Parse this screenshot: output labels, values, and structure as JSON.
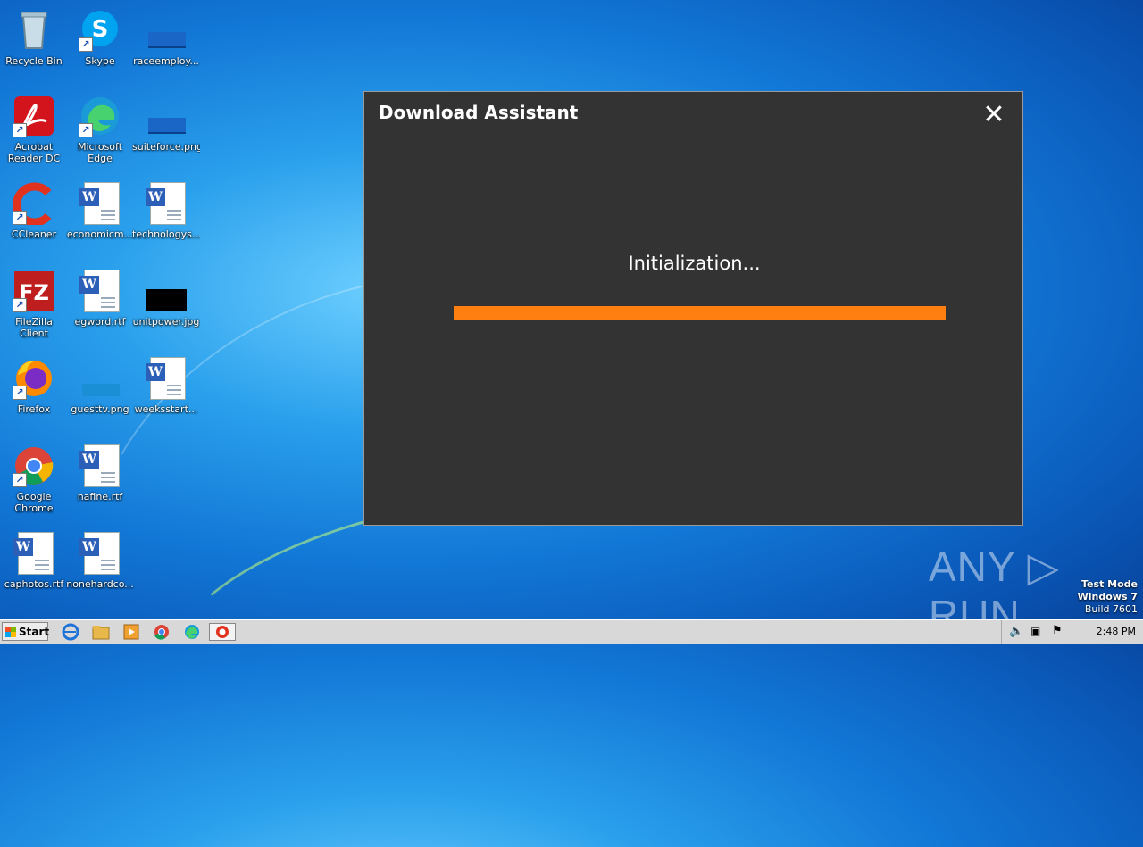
{
  "dialog": {
    "title": "Download Assistant",
    "close_symbol": "✕",
    "status": "Initialization...",
    "progress": 1.0,
    "accent_color": "#ff7f11"
  },
  "desktop": {
    "icons": [
      {
        "label": "Recycle Bin",
        "icon": "recycle-bin-icon"
      },
      {
        "label": "Skype",
        "icon": "skype-icon"
      },
      {
        "label": "raceemploy...",
        "icon": "image-file-icon"
      },
      {
        "label": "Acrobat Reader DC",
        "icon": "acrobat-icon"
      },
      {
        "label": "Microsoft Edge",
        "icon": "edge-icon"
      },
      {
        "label": "suiteforce.png",
        "icon": "image-file-icon"
      },
      {
        "label": "CCleaner",
        "icon": "ccleaner-icon"
      },
      {
        "label": "economicm...",
        "icon": "word-doc-icon"
      },
      {
        "label": "technologys...",
        "icon": "word-doc-icon"
      },
      {
        "label": "FileZilla Client",
        "icon": "filezilla-icon"
      },
      {
        "label": "egword.rtf",
        "icon": "word-doc-icon"
      },
      {
        "label": "unitpower.jpg",
        "icon": "image-file-icon"
      },
      {
        "label": "Firefox",
        "icon": "firefox-icon"
      },
      {
        "label": "guesttv.png",
        "icon": "image-file-icon"
      },
      {
        "label": "weeksstart...",
        "icon": "word-doc-icon"
      },
      {
        "label": "Google Chrome",
        "icon": "chrome-icon"
      },
      {
        "label": "nafine.rtf",
        "icon": "word-doc-icon"
      },
      {
        "label": "caphotos.rtf",
        "icon": "word-doc-icon"
      },
      {
        "label": "nonehardco...",
        "icon": "word-doc-icon"
      }
    ]
  },
  "watermark": {
    "text": "ANY ▷ RUN"
  },
  "test_mode": {
    "line1": "Test Mode",
    "line2": "Windows 7",
    "line3": "Build 7601"
  },
  "taskbar": {
    "start_label": "Start",
    "clock": "2:48 PM"
  }
}
